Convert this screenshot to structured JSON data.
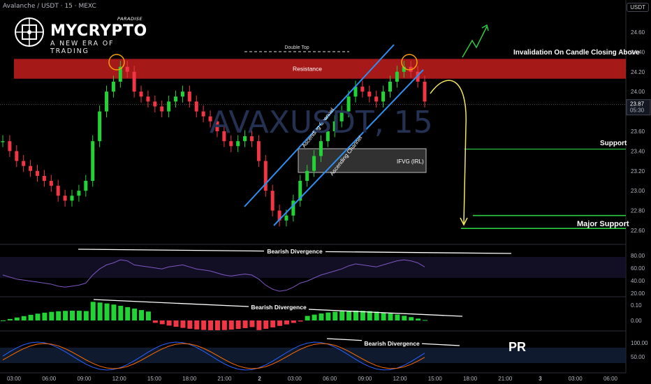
{
  "header": {
    "symbol_line": "Avalanche / USDT · 15 · MEXC",
    "currency_button": "USDT"
  },
  "logo": {
    "brand": "MYCRYPTO",
    "paradise": "PARADISE",
    "tagline": "A NEW ERA OF TRADING"
  },
  "watermark": "AVAXUSDT, 15",
  "price_axis": {
    "ticks": [
      "24.60",
      "24.40",
      "24.20",
      "24.00",
      "23.80",
      "23.60",
      "23.40",
      "23.20",
      "23.00",
      "22.80",
      "22.60"
    ],
    "current_price": "23.87",
    "countdown": "05:30"
  },
  "time_axis": {
    "ticks": [
      "03:00",
      "06:00",
      "09:00",
      "12:00",
      "15:00",
      "18:00",
      "21:00",
      "2",
      "03:00",
      "06:00",
      "09:00",
      "12:00",
      "15:00",
      "18:00",
      "21:00",
      "3",
      "03:00",
      "06:00"
    ]
  },
  "annotations": {
    "double_top": "Double Top",
    "resistance": "Resistance",
    "invalidation": "Invalidation On Candle Closing Above",
    "support": "Support",
    "major_support": "Major Support",
    "ifvg": "IFVG (IRL)",
    "ascending_channel_1": "Ascending Channel",
    "ascending_channel_2": "Ascending Channel",
    "rsi_divergence": "Bearish Divergence",
    "macd_divergence": "Bearish Divergence",
    "stoch_divergence": "Bearish Divergence",
    "pr_badge": "PR"
  },
  "indicator_axes": {
    "rsi_ticks": [
      "80.00",
      "60.00",
      "40.00",
      "20.00"
    ],
    "macd_ticks": [
      "0.10",
      "0.00"
    ],
    "stoch_ticks": [
      "100.00",
      "50.00"
    ]
  },
  "colors": {
    "up": "#22d335",
    "down": "#f23645",
    "resistance_zone": "#b71c1c",
    "channel": "#2f8ff0",
    "support_line": "#2ecc40",
    "projection": "#f5e663",
    "rsi_line": "#7e57c2",
    "stoch_k": "#2962ff",
    "stoch_d": "#ff6d00"
  },
  "chart_data": {
    "type": "candlestick",
    "title": "AVAXUSDT, 15",
    "levels": {
      "resistance_zone": [
        24.13,
        24.33
      ],
      "support": 23.42,
      "major_support": [
        22.62,
        22.75
      ]
    },
    "price_series_approx": [
      23.5,
      23.4,
      23.3,
      23.25,
      23.2,
      23.15,
      23.1,
      23.05,
      22.95,
      22.9,
      22.95,
      23.0,
      23.1,
      23.5,
      23.8,
      24.0,
      24.1,
      24.25,
      24.2,
      24.0,
      23.95,
      23.9,
      23.85,
      23.8,
      23.9,
      23.95,
      24.0,
      23.9,
      23.8,
      23.75,
      23.7,
      23.6,
      23.5,
      23.45,
      23.5,
      23.55,
      23.5,
      23.3,
      23.0,
      22.8,
      22.7,
      22.75,
      22.9,
      23.1,
      23.2,
      23.35,
      23.5,
      23.6,
      23.7,
      23.8,
      23.95,
      24.05,
      24.0,
      23.95,
      23.9,
      24.0,
      24.1,
      24.2,
      24.25,
      24.2,
      24.1,
      23.9
    ],
    "rsi_range": [
      20,
      80
    ],
    "macd_range": [
      -0.05,
      0.12
    ],
    "stoch_range": [
      0,
      100
    ]
  }
}
